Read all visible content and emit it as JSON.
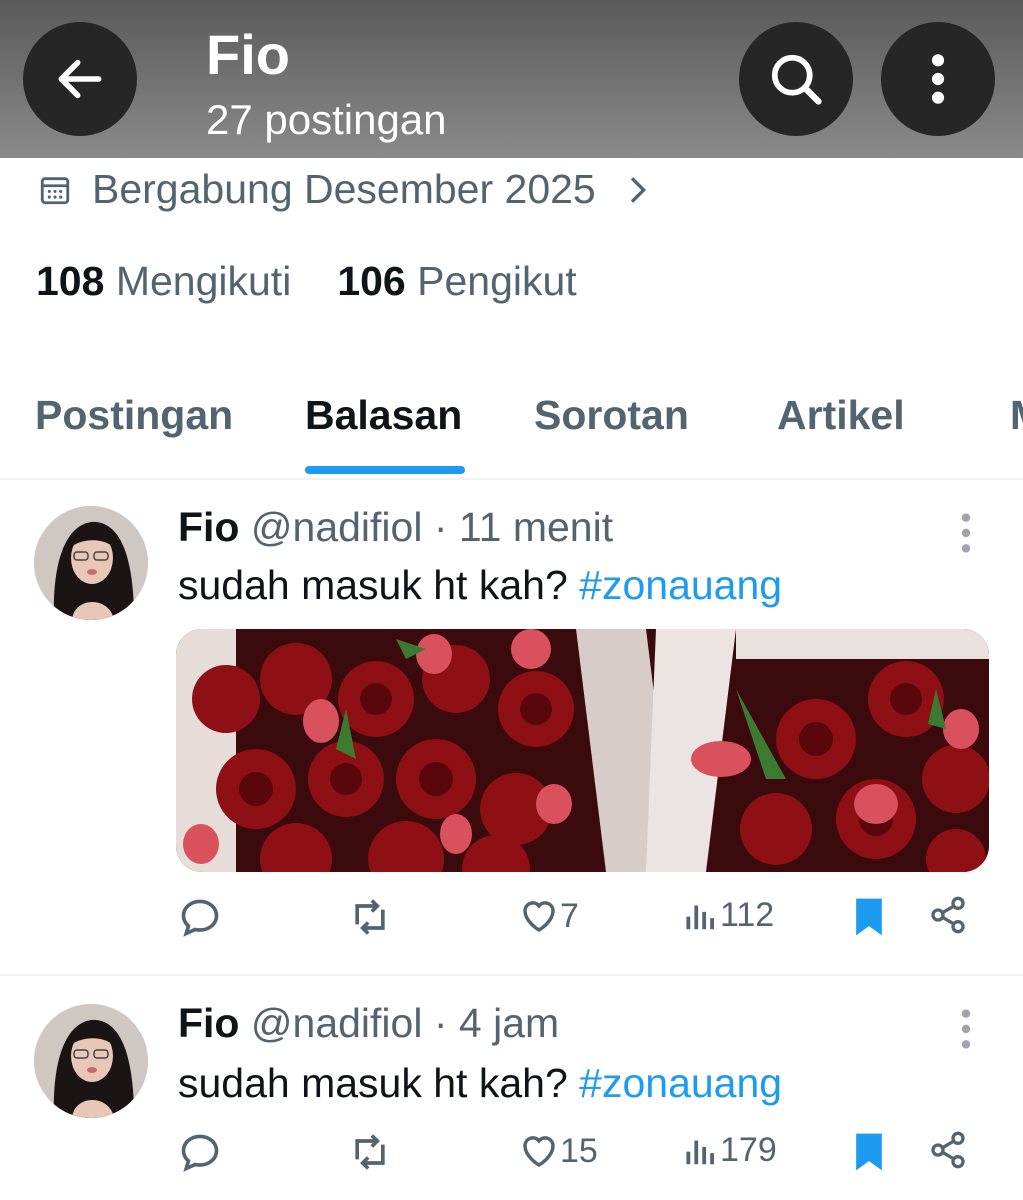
{
  "header": {
    "name": "Fio",
    "post_count": "27 postingan",
    "back_icon": "arrow-left-icon",
    "search_icon": "search-icon",
    "more_icon": "more-vertical-icon"
  },
  "profile": {
    "joined": "Bergabung Desember 2025",
    "following_count": "108",
    "following_label": "Mengikuti",
    "followers_count": "106",
    "followers_label": "Pengikut"
  },
  "tabs": [
    {
      "label": "Postingan",
      "active": false
    },
    {
      "label": "Balasan",
      "active": true
    },
    {
      "label": "Sorotan",
      "active": false
    },
    {
      "label": "Artikel",
      "active": false
    },
    {
      "label": "M",
      "active": false
    }
  ],
  "colors": {
    "accent": "#1d9bf0",
    "muted": "#536471",
    "text": "#0f1419"
  },
  "posts": [
    {
      "name": "Fio",
      "handle": "@nadifiol",
      "time": "· 11 menit",
      "text": "sudah masuk ht kah?",
      "hashtag": "#zonauang",
      "has_media": true,
      "likes": "7",
      "views": "112"
    },
    {
      "name": "Fio",
      "handle": "@nadifiol",
      "time": "· 4 jam",
      "text": "sudah masuk ht kah?",
      "hashtag": "#zonauang",
      "has_media": false,
      "likes": "15",
      "views": "179"
    }
  ]
}
